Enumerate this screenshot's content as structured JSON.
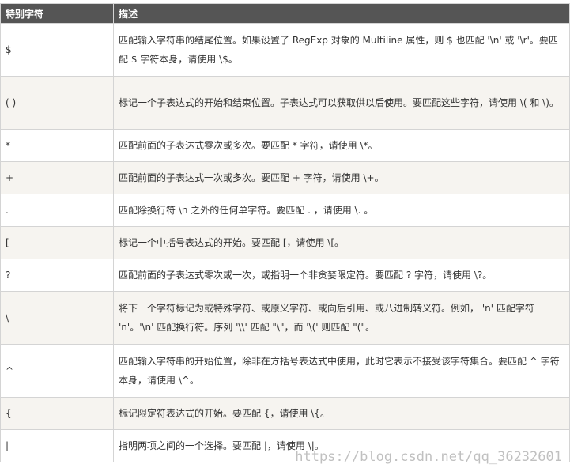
{
  "table": {
    "headers": [
      "特别字符",
      "描述"
    ],
    "rows": [
      {
        "char": "$",
        "desc": "匹配输入字符串的结尾位置。如果设置了 RegExp 对象的 Multiline 属性，则 $ 也匹配 '\\n' 或 '\\r'。要匹配 $ 字符本身，请使用 \\$。"
      },
      {
        "char": "( )",
        "desc": "标记一个子表达式的开始和结束位置。子表达式可以获取供以后使用。要匹配这些字符，请使用 \\( 和 \\)。"
      },
      {
        "char": "*",
        "desc": "匹配前面的子表达式零次或多次。要匹配 * 字符，请使用 \\*。"
      },
      {
        "char": "+",
        "desc": "匹配前面的子表达式一次或多次。要匹配 + 字符，请使用 \\+。"
      },
      {
        "char": ".",
        "desc": "匹配除换行符 \\n 之外的任何单字符。要匹配 . ，请使用 \\. 。"
      },
      {
        "char": "[",
        "desc": "标记一个中括号表达式的开始。要匹配 [，请使用 \\[。"
      },
      {
        "char": "?",
        "desc": "匹配前面的子表达式零次或一次，或指明一个非贪婪限定符。要匹配 ? 字符，请使用 \\?。"
      },
      {
        "char": "\\",
        "desc": "将下一个字符标记为或特殊字符、或原义字符、或向后引用、或八进制转义符。例如， 'n' 匹配字符 'n'。'\\n' 匹配换行符。序列 '\\\\' 匹配 \"\\\"，而 '\\(' 则匹配 \"(\"。"
      },
      {
        "char": "^",
        "desc": "匹配输入字符串的开始位置，除非在方括号表达式中使用，此时它表示不接受该字符集合。要匹配 ^ 字符本身，请使用 \\^。"
      },
      {
        "char": "{",
        "desc": "标记限定符表达式的开始。要匹配 {，请使用 \\{。"
      },
      {
        "char": "|",
        "desc": "指明两项之间的一个选择。要匹配 |，请使用 \\|。"
      }
    ]
  },
  "watermark": "https://blog.csdn.net/qq_36232601"
}
